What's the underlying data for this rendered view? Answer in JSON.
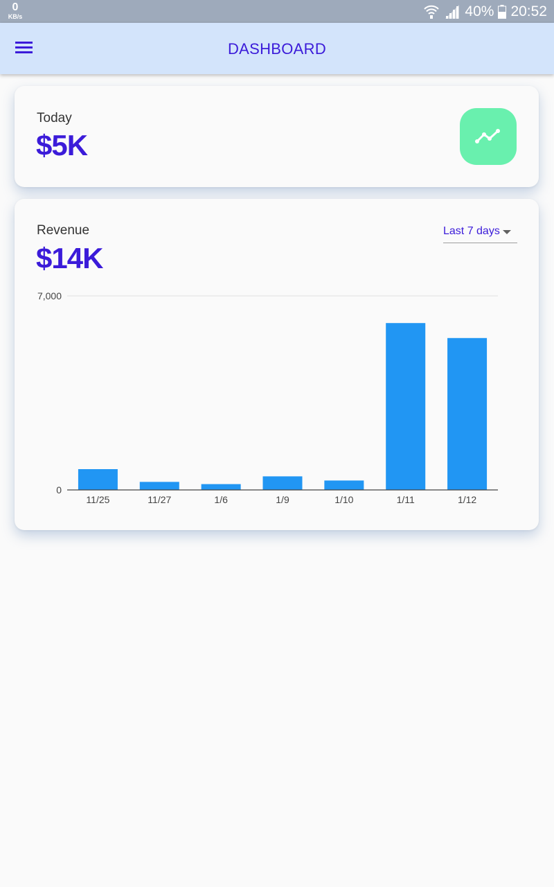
{
  "status_bar": {
    "speed_value": "0",
    "speed_unit": "KB/s",
    "battery": "40%",
    "time": "20:52"
  },
  "app_bar": {
    "title": "DASHBOARD",
    "menu_icon": "hamburger-menu-icon"
  },
  "today_card": {
    "label": "Today",
    "value": "$5K",
    "icon": "trending-line-icon",
    "icon_bg_color": "#69f0ae"
  },
  "revenue_card": {
    "label": "Revenue",
    "value": "$14K",
    "range_select": {
      "selected": "Last 7 days"
    }
  },
  "colors": {
    "accent": "#3b1bd9",
    "bar": "#2196f3",
    "appbar_bg": "#d3e4fb",
    "statusbar_bg": "#9eaabb"
  },
  "chart_data": {
    "type": "bar",
    "categories": [
      "11/25",
      "11/27",
      "1/6",
      "1/9",
      "1/10",
      "1/11",
      "1/12"
    ],
    "values": [
      750,
      290,
      210,
      490,
      340,
      6020,
      5480
    ],
    "y_tick_labels": [
      "0",
      "7,000"
    ],
    "ylim": [
      0,
      7000
    ],
    "grid": true
  }
}
